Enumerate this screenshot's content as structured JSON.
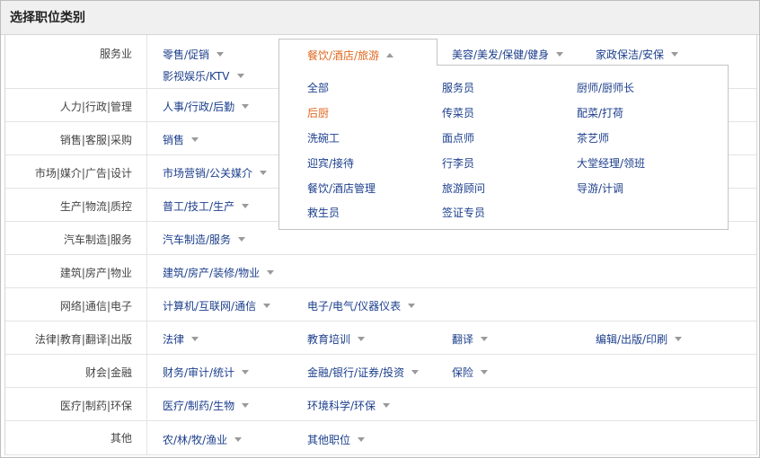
{
  "dialog": {
    "title": "选择职位类别"
  },
  "categories": [
    {
      "label": "服务业",
      "items": [
        "零售/促销",
        "美容/美发/保健/健身",
        "家政保洁/安保",
        "影视娱乐/KTV"
      ]
    },
    {
      "label": "人力|行政|管理",
      "items": [
        "人事/行政/后勤"
      ]
    },
    {
      "label": "销售|客服|采购",
      "items": [
        "销售"
      ]
    },
    {
      "label": "市场|媒介|广告|设计",
      "items": [
        "市场营销/公关媒介"
      ]
    },
    {
      "label": "生产|物流|质控",
      "items": [
        "普工/技工/生产"
      ]
    },
    {
      "label": "汽车制造|服务",
      "items": [
        "汽车制造/服务"
      ]
    },
    {
      "label": "建筑|房产|物业",
      "items": [
        "建筑/房产/装修/物业"
      ]
    },
    {
      "label": "网络|通信|电子",
      "items": [
        "计算机/互联网/通信",
        "电子/电气/仪器仪表"
      ]
    },
    {
      "label": "法律|教育|翻译|出版",
      "items": [
        "法律",
        "教育培训",
        "翻译",
        "编辑/出版/印刷"
      ]
    },
    {
      "label": "财会|金融",
      "items": [
        "财务/审计/统计",
        "金融/银行/证券/投资",
        "保险"
      ]
    },
    {
      "label": "医疗|制药|环保",
      "items": [
        "医疗/制药/生物",
        "环境科学/环保"
      ]
    },
    {
      "label": "其他",
      "items": [
        "农/林/牧/渔业",
        "其他职位"
      ]
    }
  ],
  "active_tab": {
    "label": "餐饮/酒店/旅游"
  },
  "dropdown": {
    "items": [
      "全部",
      "服务员",
      "厨师/厨师长",
      "后厨",
      "传菜员",
      "配菜/打荷",
      "洗碗工",
      "面点师",
      "茶艺师",
      "迎宾/接待",
      "行李员",
      "大堂经理/领班",
      "餐饮/酒店管理",
      "旅游顾问",
      "导游/计调",
      "救生员",
      "签证专员"
    ],
    "selected": "后厨"
  },
  "colors": {
    "link": "#1c3f8c",
    "active": "#e0681e",
    "border": "#c4c4c4"
  }
}
